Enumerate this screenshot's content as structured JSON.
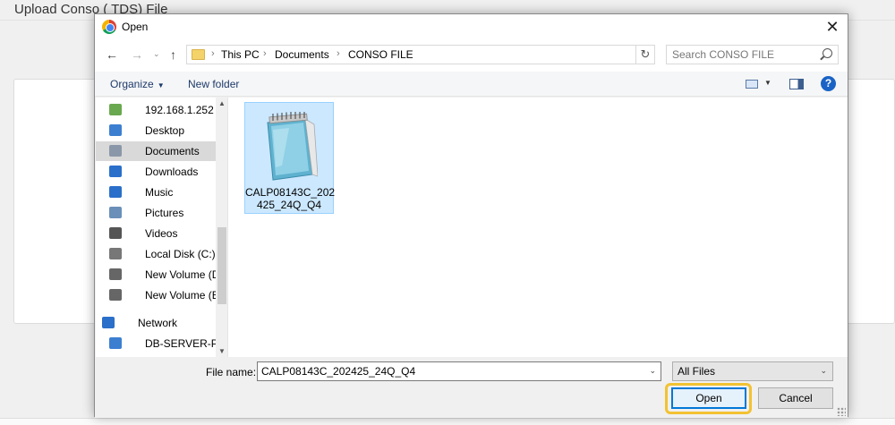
{
  "page": {
    "title": "Upload Conso ( TDS) File"
  },
  "dialog": {
    "title": "Open",
    "close_label": "✕"
  },
  "nav": {
    "back": "←",
    "forward": "→",
    "recent": "⌄",
    "up": "↑",
    "breadcrumb": [
      "This PC",
      "Documents",
      "CONSO FILE"
    ],
    "separator": "›",
    "refresh": "↻",
    "search_placeholder": "Search CONSO FILE"
  },
  "toolbar": {
    "organize": "Organize",
    "new_folder": "New folder",
    "help": "?"
  },
  "sidebar": {
    "items": [
      {
        "label": "192.168.1.252",
        "icon": "network-drive-icon",
        "color": "#6aa84f"
      },
      {
        "label": "Desktop",
        "icon": "desktop-icon",
        "color": "#3c7fd1"
      },
      {
        "label": "Documents",
        "icon": "documents-icon",
        "color": "#8a97a8",
        "selected": true
      },
      {
        "label": "Downloads",
        "icon": "downloads-icon",
        "color": "#2a6fc9"
      },
      {
        "label": "Music",
        "icon": "music-icon",
        "color": "#2a6fc9"
      },
      {
        "label": "Pictures",
        "icon": "pictures-icon",
        "color": "#6a8fb8"
      },
      {
        "label": "Videos",
        "icon": "videos-icon",
        "color": "#555555"
      },
      {
        "label": "Local Disk (C:)",
        "icon": "local-disk-icon",
        "color": "#777777"
      },
      {
        "label": "New Volume (D:)",
        "icon": "drive-icon",
        "color": "#666666"
      },
      {
        "label": "New Volume (E:)",
        "icon": "drive-icon",
        "color": "#666666"
      },
      {
        "label": "Network",
        "icon": "network-icon",
        "color": "#2a6fc9"
      },
      {
        "label": "DB-SERVER-PC",
        "icon": "computer-icon",
        "color": "#3c7fd1"
      }
    ]
  },
  "files": [
    {
      "name_line1": "CALP08143C_202",
      "name_line2": "425_24Q_Q4",
      "icon": "notepad-icon",
      "selected": true
    }
  ],
  "footer": {
    "file_name_label": "File name:",
    "file_name_value": "CALP08143C_202425_24Q_Q4",
    "file_type": "All Files",
    "open_label": "Open",
    "cancel_label": "Cancel",
    "highlight_color": "#f2c232"
  }
}
